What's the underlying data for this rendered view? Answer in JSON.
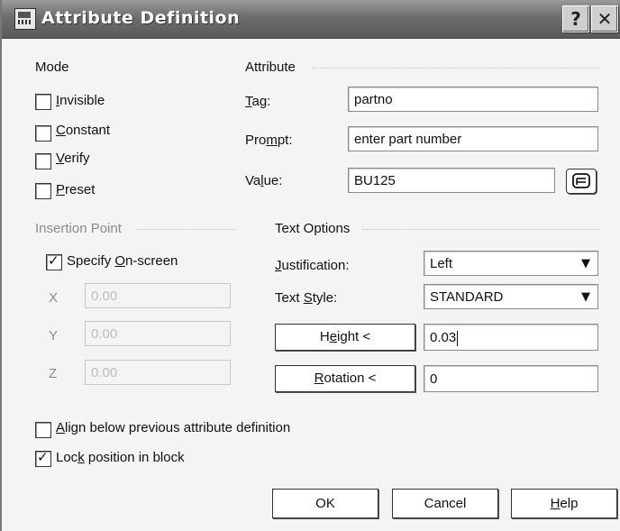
{
  "window": {
    "title": "Attribute Definition",
    "help_glyph": "?",
    "close_glyph": "✕"
  },
  "mode": {
    "heading": "Mode",
    "items": [
      {
        "pre": "",
        "key": "I",
        "post": "nvisible",
        "checked": false
      },
      {
        "pre": "",
        "key": "C",
        "post": "onstant",
        "checked": false
      },
      {
        "pre": "",
        "key": "V",
        "post": "erify",
        "checked": false
      },
      {
        "pre": "",
        "key": "P",
        "post": "reset",
        "checked": false
      }
    ]
  },
  "attribute": {
    "heading": "Attribute",
    "tag": {
      "pre": "",
      "key": "T",
      "post": "ag:",
      "value": "partno"
    },
    "prompt": {
      "pre": "Pro",
      "key": "m",
      "post": "pt:",
      "value": "enter part number"
    },
    "value": {
      "pre": "Va",
      "key": "l",
      "post": "ue:",
      "value": "BU125"
    },
    "field_button_icon": "insert-field-icon"
  },
  "insertion": {
    "heading": "Insertion Point",
    "specify": {
      "pre": "Specify ",
      "key": "O",
      "post": "n-screen",
      "checked": true
    },
    "coords": [
      {
        "label": "X",
        "value": "0.00"
      },
      {
        "label": "Y",
        "value": "0.00"
      },
      {
        "label": "Z",
        "value": "0.00"
      }
    ]
  },
  "text_options": {
    "heading": "Text Options",
    "justification": {
      "pre": "",
      "key": "J",
      "post": "ustification:",
      "value": "Left"
    },
    "style": {
      "pre": "Text ",
      "key": "S",
      "post": "tyle:",
      "value": "STANDARD"
    },
    "height": {
      "pre": "H",
      "key": "e",
      "post": "ight <",
      "value": "0.03"
    },
    "rotation": {
      "pre": "",
      "key": "R",
      "post": "otation <",
      "value": "0"
    }
  },
  "align": {
    "pre": "",
    "key": "A",
    "post": "lign below previous attribute definition",
    "checked": false
  },
  "lock": {
    "pre": "Loc",
    "key": "k",
    "post": " position in block",
    "checked": true
  },
  "buttons": {
    "ok": "OK",
    "cancel": "Cancel",
    "help": {
      "pre": "",
      "key": "H",
      "post": "elp"
    }
  }
}
